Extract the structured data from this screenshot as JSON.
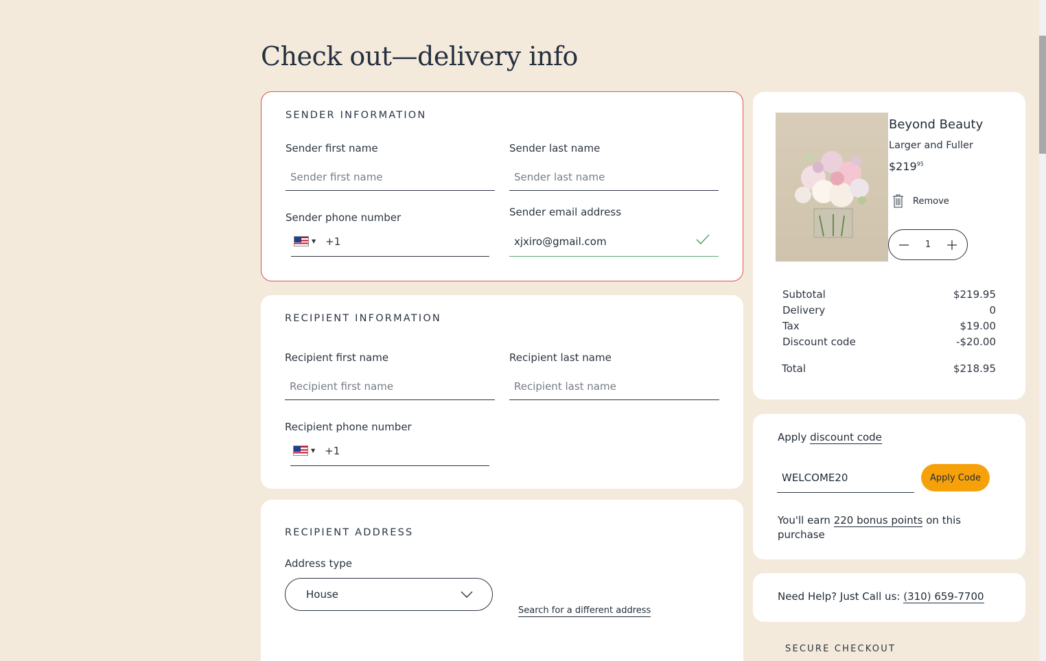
{
  "page": {
    "title": "Check out—delivery info"
  },
  "sender": {
    "section_title": "SENDER INFORMATION",
    "first_name_label": "Sender first name",
    "first_name_placeholder": "Sender first name",
    "last_name_label": "Sender last name",
    "last_name_placeholder": "Sender last name",
    "phone_label": "Sender phone number",
    "phone_dial_code": "+1",
    "email_label": "Sender email address",
    "email_value": "xjxiro@gmail.com"
  },
  "recipient": {
    "section_title": "RECIPIENT INFORMATION",
    "first_name_label": "Recipient first name",
    "first_name_placeholder": "Recipient first name",
    "last_name_label": "Recipient last name",
    "last_name_placeholder": "Recipient last name",
    "phone_label": "Recipient phone number",
    "phone_dial_code": "+1"
  },
  "address": {
    "section_title": "RECIPIENT ADDRESS",
    "type_label": "Address type",
    "type_value": "House",
    "search_link": "Search for a different address"
  },
  "product": {
    "name": "Beyond Beauty",
    "variant": "Larger and Fuller",
    "price_main": "$219",
    "price_cents": "95",
    "remove_label": "Remove",
    "quantity": "1"
  },
  "summary": {
    "rows": [
      {
        "label": "Subtotal",
        "value": "$219.95"
      },
      {
        "label": "Delivery",
        "value": "0"
      },
      {
        "label": "Tax",
        "value": "$19.00"
      },
      {
        "label": "Discount code",
        "value": "-$20.00"
      }
    ],
    "total_label": "Total",
    "total_value": "$218.95"
  },
  "discount": {
    "prefix": "Apply",
    "link": "discount code",
    "code_value": "WELCOME20",
    "button_label": "Apply Code",
    "earn_prefix": "You'll earn",
    "earn_points": "220 bonus points",
    "earn_suffix": "on this purchase"
  },
  "help": {
    "text": "Need Help? Just Call us:",
    "phone": "(310) 659-7700"
  },
  "footer": {
    "secure_label": "SECURE CHECKOUT"
  },
  "colors": {
    "accent": "#f7a10a",
    "error_border": "#d9534f",
    "valid": "#5aa86f",
    "background": "#f4eadb"
  }
}
